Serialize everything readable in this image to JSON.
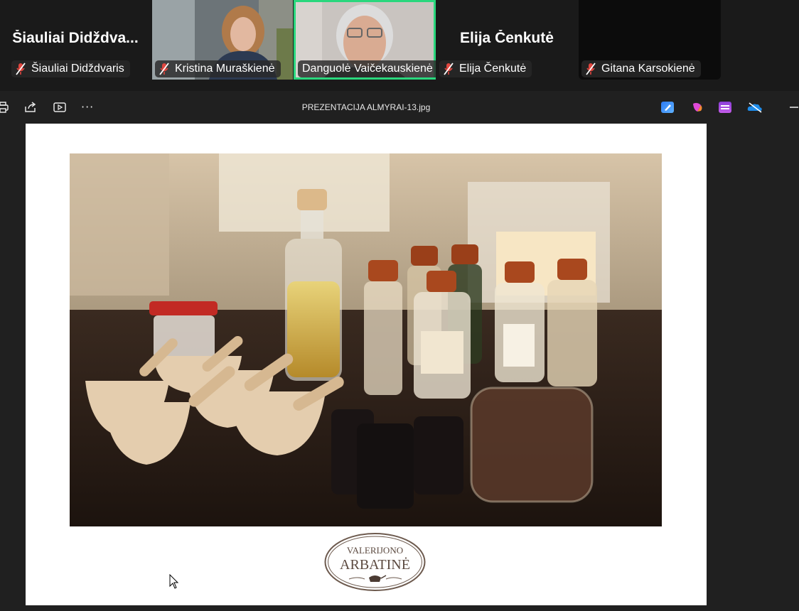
{
  "participants": [
    {
      "big_name": "Šiauliai  Didždva...",
      "name": "Šiauliai Didždvaris",
      "muted": true,
      "video": false
    },
    {
      "name": "Kristina Muraškienė",
      "muted": true,
      "video": true
    },
    {
      "name": "Danguolė Vaičekauskienė",
      "muted": false,
      "video": true,
      "active_speaker": true
    },
    {
      "big_name": "Elija Čenkutė",
      "name": "Elija Čenkutė",
      "muted": true,
      "video": false
    },
    {
      "name": "Gitana Karsokienė",
      "muted": true,
      "video": false
    }
  ],
  "toolbar": {
    "file_title": "PREZENTACIJA ALMYRAI-13.jpg",
    "more_label": "···"
  },
  "slide": {
    "logo_line1": "VALERIJONO",
    "logo_line2": "ARBATINĖ"
  },
  "colors": {
    "active_speaker": "#2ad77d",
    "mute_icon": "#e0463f"
  }
}
